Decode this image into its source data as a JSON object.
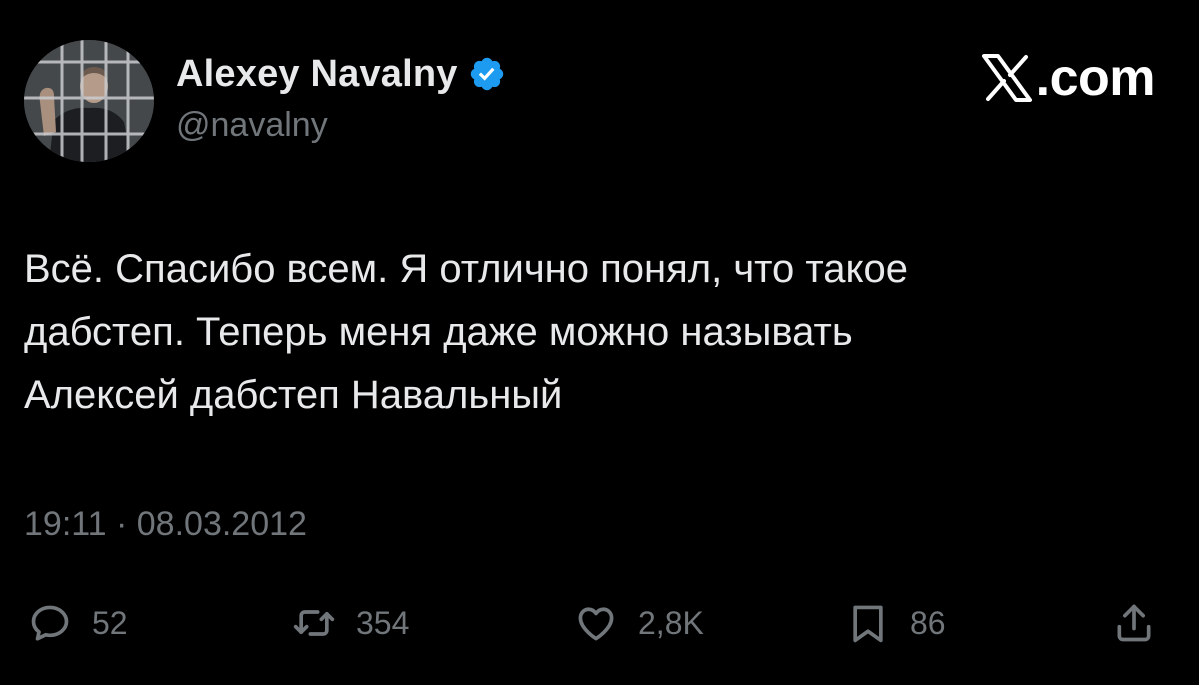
{
  "author": {
    "display_name": "Alexey Navalny",
    "handle": "@navalny",
    "verified": true,
    "avatar_icon": "avatar-photo"
  },
  "brand": {
    "icon": "x-logo-icon",
    "label": "com",
    "dot": "."
  },
  "tweet": {
    "lines": [
      "Всё. Спасибо всем. Я отлично понял, что такое",
      "дабстеп. Теперь меня даже можно называть",
      "Алексей дабстеп Навальный"
    ],
    "timestamp": "19:11 · 08.03.2012"
  },
  "actions": {
    "reply": {
      "icon": "reply-icon",
      "count": "52"
    },
    "repost": {
      "icon": "repost-icon",
      "count": "354"
    },
    "like": {
      "icon": "heart-icon",
      "count": "2,8K"
    },
    "bookmark": {
      "icon": "bookmark-icon",
      "count": "86"
    },
    "share": {
      "icon": "share-icon"
    }
  },
  "colors": {
    "background": "#000000",
    "primary_text": "#e7e9ea",
    "secondary_text": "#71767b",
    "verified_badge": "#1d9bf0"
  }
}
